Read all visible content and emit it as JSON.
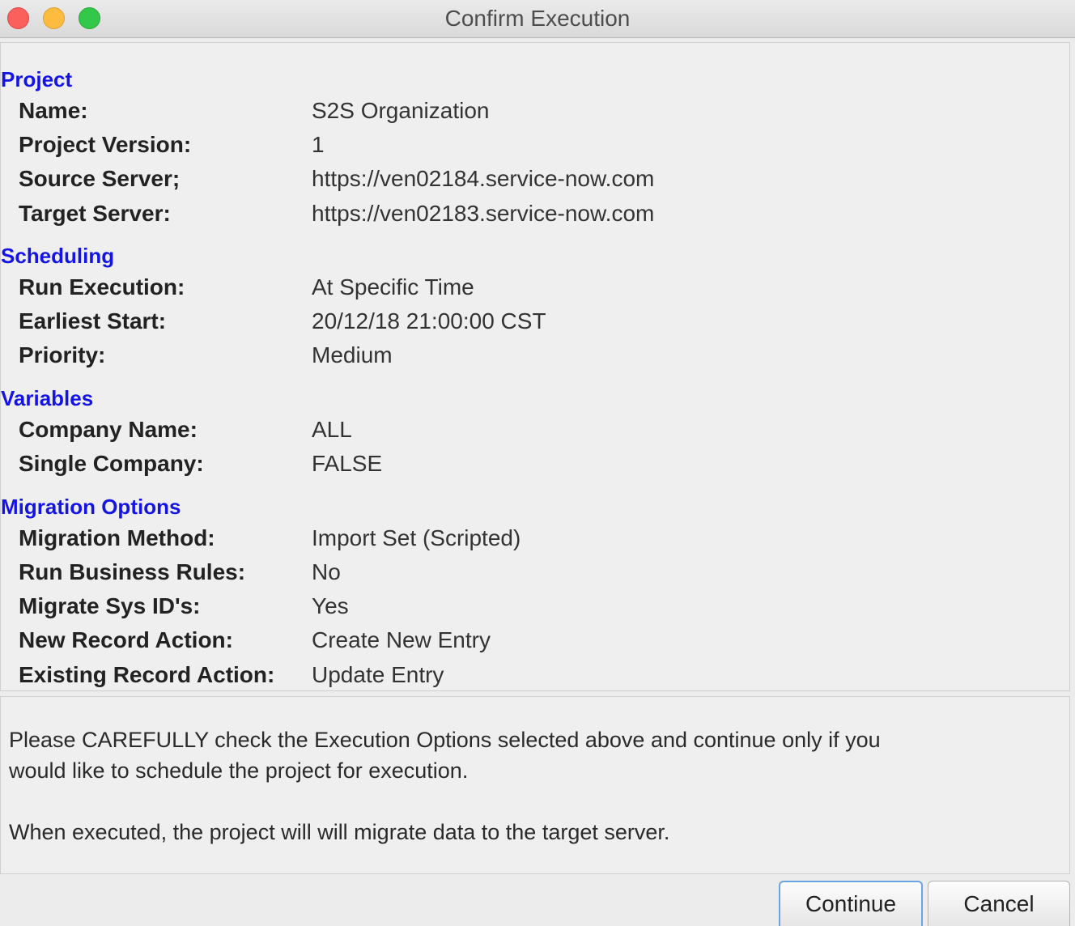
{
  "window": {
    "title": "Confirm Execution"
  },
  "sections": {
    "project": {
      "title": "Project",
      "rows": [
        {
          "label": "Name:",
          "value": "S2S Organization"
        },
        {
          "label": "Project Version:",
          "value": "1"
        },
        {
          "label": "Source Server;",
          "value": "https://ven02184.service-now.com"
        },
        {
          "label": "Target Server:",
          "value": "https://ven02183.service-now.com"
        }
      ]
    },
    "scheduling": {
      "title": "Scheduling",
      "rows": [
        {
          "label": "Run Execution:",
          "value": "At Specific Time"
        },
        {
          "label": "Earliest Start:",
          "value": "20/12/18 21:00:00 CST"
        },
        {
          "label": "Priority:",
          "value": "Medium"
        }
      ]
    },
    "variables": {
      "title": "Variables",
      "rows": [
        {
          "label": "Company Name:",
          "value": "ALL"
        },
        {
          "label": "Single Company:",
          "value": "FALSE"
        }
      ]
    },
    "migration": {
      "title": "Migration Options",
      "rows": [
        {
          "label": "Migration Method:",
          "value": "Import Set (Scripted)"
        },
        {
          "label": "Run Business Rules:",
          "value": "No"
        },
        {
          "label": "Migrate Sys ID's:",
          "value": "Yes"
        },
        {
          "label": "New Record Action:",
          "value": "Create New Entry"
        },
        {
          "label": "Existing Record Action:",
          "value": "Update Entry"
        }
      ]
    }
  },
  "message": {
    "line1": "Please CAREFULLY check the Execution Options selected above and continue only if you",
    "line2": "would like to schedule the project for execution.",
    "line3": "When executed, the project will will migrate data to the target server."
  },
  "buttons": {
    "continue_label": "Continue",
    "cancel_label": "Cancel"
  },
  "colors": {
    "section_title": "#1414e6",
    "close": "#fc605c",
    "minimize": "#fdbc40",
    "maximize": "#34c84a",
    "default_button_border": "#6aa4e4"
  }
}
